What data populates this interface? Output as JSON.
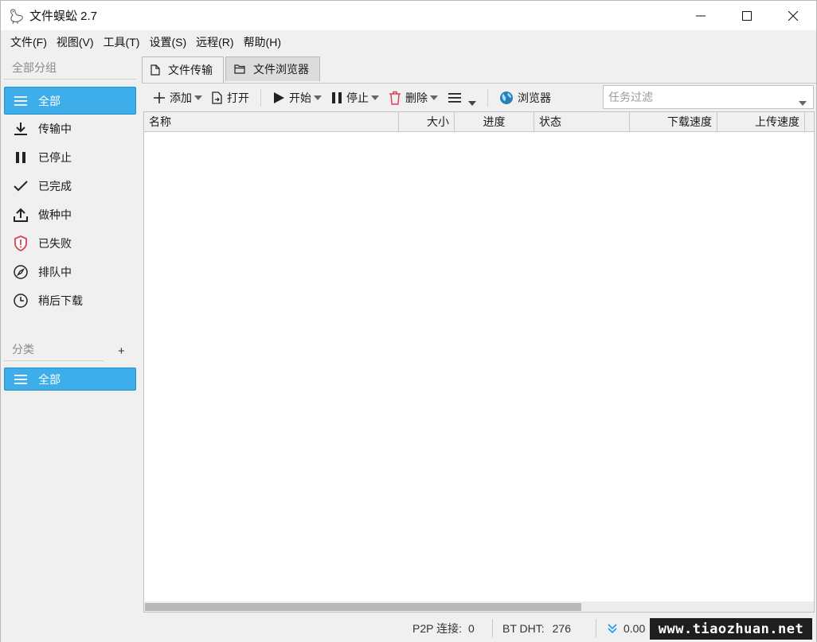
{
  "window": {
    "title": "文件蜈蚣 2.7",
    "controls": [
      "minimize-icon",
      "maximize-icon",
      "close-icon"
    ]
  },
  "menu": {
    "items": [
      "文件(F)",
      "视图(V)",
      "工具(T)",
      "设置(S)",
      "远程(R)",
      "帮助(H)"
    ]
  },
  "sidebar": {
    "groups_heading": "全部分组",
    "items": [
      {
        "label": "全部",
        "icon": "list-icon",
        "active": true
      },
      {
        "label": "传输中",
        "icon": "download-icon"
      },
      {
        "label": "已停止",
        "icon": "pause-icon"
      },
      {
        "label": "已完成",
        "icon": "check-icon"
      },
      {
        "label": "做种中",
        "icon": "upload-icon"
      },
      {
        "label": "已失败",
        "icon": "shield-alert-icon"
      },
      {
        "label": "排队中",
        "icon": "compass-icon"
      },
      {
        "label": "稍后下载",
        "icon": "clock-icon"
      }
    ],
    "category_heading": "分类",
    "add_category": "+",
    "category_items": [
      {
        "label": "全部",
        "icon": "list-icon",
        "active": true
      }
    ]
  },
  "tabs": [
    {
      "label": "文件传输",
      "icon": "file-icon",
      "active": true
    },
    {
      "label": "文件浏览器",
      "icon": "folder-icon",
      "active": false
    }
  ],
  "toolbar": {
    "add": "添加",
    "open": "打开",
    "start": "开始",
    "stop": "停止",
    "delete": "删除",
    "browser": "浏览器",
    "filter_placeholder": "任务过滤"
  },
  "table": {
    "columns": [
      {
        "label": "名称",
        "align": "left"
      },
      {
        "label": "大小",
        "align": "right"
      },
      {
        "label": "进度",
        "align": "center"
      },
      {
        "label": "状态",
        "align": "left"
      },
      {
        "label": "下载速度",
        "align": "right"
      },
      {
        "label": "上传速度",
        "align": "right"
      }
    ],
    "rows": []
  },
  "status": {
    "p2p_label": "P2P 连接:",
    "p2p_value": "0",
    "dht_label": "BT DHT:",
    "dht_value": "276",
    "down_speed": "0.00"
  },
  "watermark": "www.tiaozhuan.net",
  "colors": {
    "accent": "#3daee9",
    "accent_border": "#2a8fc4",
    "delete_red": "#da4453",
    "browser_blue": "#2980b9",
    "status_blue": "#1d99f3"
  }
}
